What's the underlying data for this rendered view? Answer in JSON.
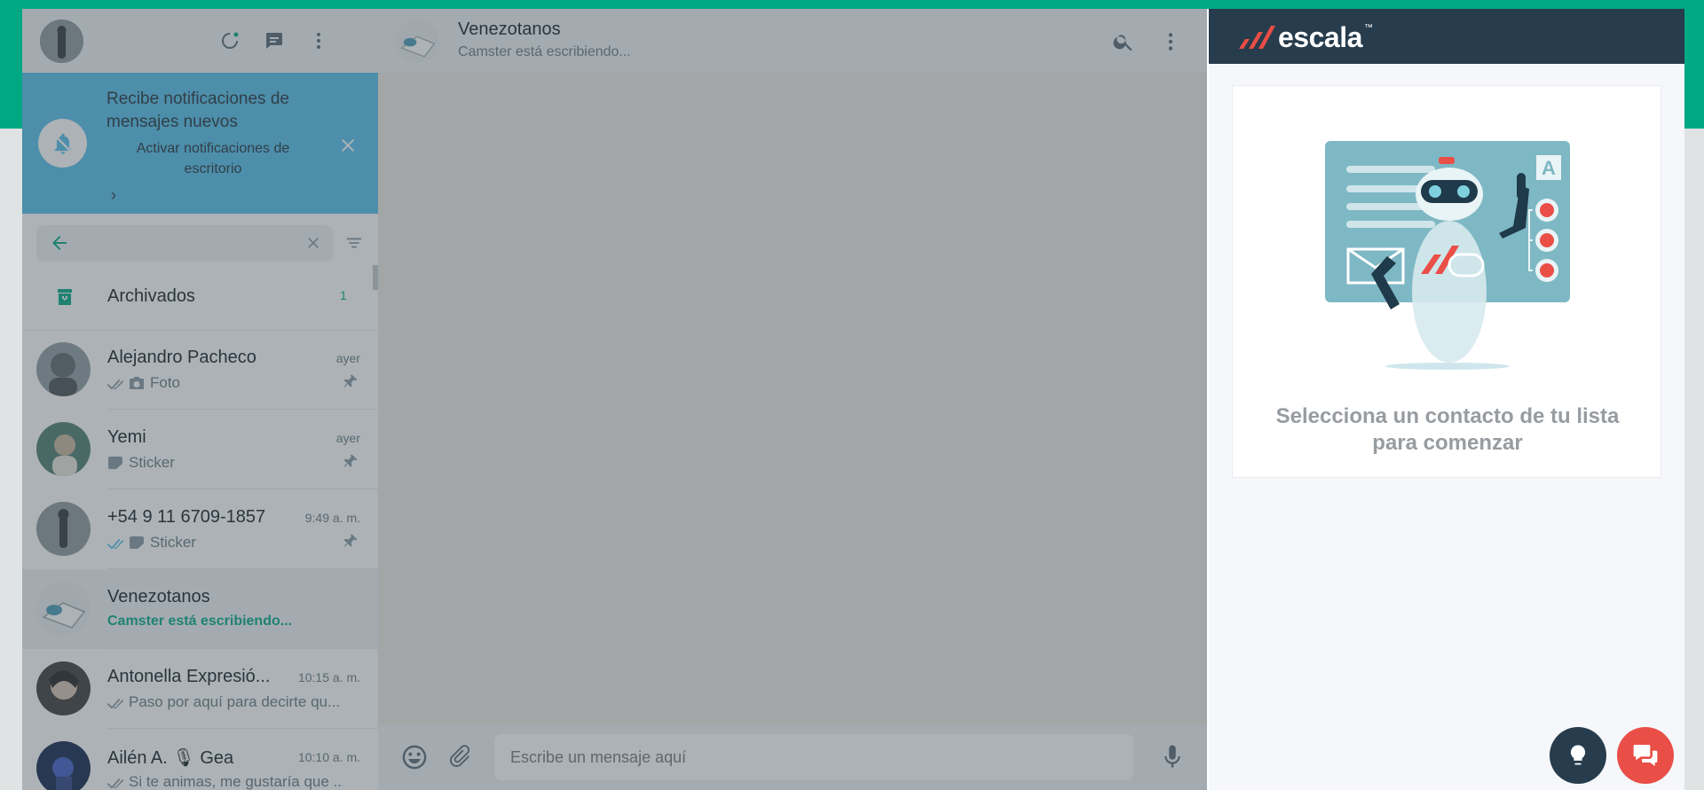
{
  "colors": {
    "accent": "#00a884",
    "notification_bg": "#53bdeb",
    "escala_header": "#273c4c",
    "escala_red": "#e94e47"
  },
  "notification": {
    "title": "Recibe notificaciones de mensajes nuevos",
    "action": "Activar notificaciones de escritorio"
  },
  "search": {
    "placeholder": ""
  },
  "archived": {
    "label": "Archivados",
    "count": "1"
  },
  "chats": [
    {
      "name": "Alejandro Pacheco",
      "time": "ayer",
      "preview": "Foto",
      "pinned": true
    },
    {
      "name": "Yemi",
      "time": "ayer",
      "preview": "Sticker",
      "pinned": true
    },
    {
      "name": "+54 9 11 6709-1857",
      "time": "9:49 a. m.",
      "preview": "Sticker",
      "pinned": true
    },
    {
      "name": "Venezotanos",
      "time": "",
      "preview": "Camster está escribiendo...",
      "active": true
    },
    {
      "name": "Antonella Expresió...",
      "time": "10:15 a. m.",
      "preview": "Paso por aquí para decirte qu..."
    },
    {
      "name": "Ailén A. 🎙 Gea",
      "time": "10:10 a. m.",
      "preview": "Si te animas, me gustaría que ..."
    }
  ],
  "conversation": {
    "name": "Venezotanos",
    "status": "Camster está escribiendo...",
    "input_placeholder": "Escribe un mensaje aquí"
  },
  "escala": {
    "logo_text": "escala",
    "logo_tm": "™",
    "illustration_letter": "A",
    "empty_message": "Selecciona un contacto de tu lista para comenzar"
  }
}
